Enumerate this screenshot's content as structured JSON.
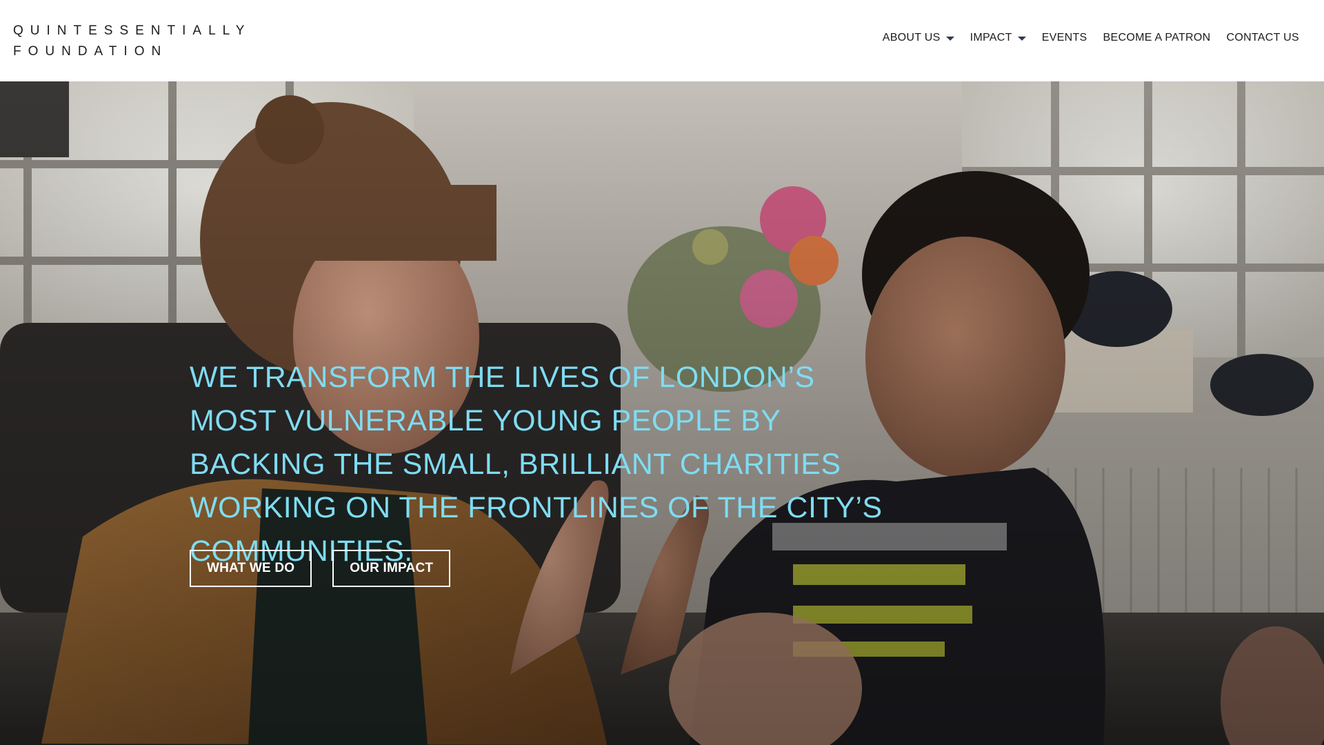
{
  "brand": {
    "line1": "QUINTESSENTIALLY",
    "line2": "FOUNDATION"
  },
  "nav": {
    "items": [
      {
        "label": "ABOUT US",
        "has_dropdown": true
      },
      {
        "label": "IMPACT",
        "has_dropdown": true
      },
      {
        "label": "EVENTS",
        "has_dropdown": false
      },
      {
        "label": "BECOME A PATRON",
        "has_dropdown": false
      },
      {
        "label": "CONTACT US",
        "has_dropdown": false
      }
    ]
  },
  "hero": {
    "headline": "WE TRANSFORM THE LIVES OF LONDON’S MOST VULNERABLE YOUNG PEOPLE BY BACKING THE SMALL, BRILLIANT CHARITIES WORKING ON THE FRONTLINES OF THE CITY’S COMMUNITIES.",
    "buttons": [
      {
        "label": "WHAT WE DO"
      },
      {
        "label": "OUR IMPACT"
      }
    ]
  },
  "colors": {
    "headline": "#7fdcf2",
    "header_bg": "#ffffff",
    "nav_text": "#1c1c1c",
    "caret": "#2f3b55",
    "button_border": "#ffffff"
  }
}
